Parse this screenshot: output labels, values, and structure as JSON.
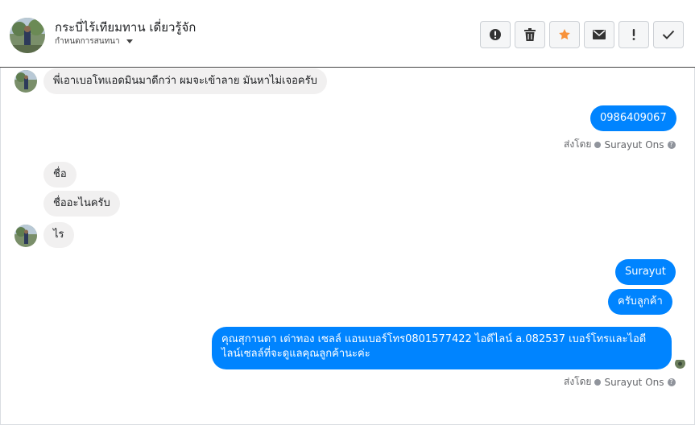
{
  "header": {
    "contact_name": "กระบี่ไร้เทียมทาน เดี่ยวรู้จัก",
    "label_text": "กำหนดการสนทนา"
  },
  "toolbar": {
    "buttons": [
      {
        "name": "spam",
        "icon": "alert-circle-icon"
      },
      {
        "name": "delete",
        "icon": "trash-icon"
      },
      {
        "name": "star",
        "icon": "star-icon",
        "color": "#f7923b"
      },
      {
        "name": "mail",
        "icon": "envelope-icon"
      },
      {
        "name": "follow-up",
        "icon": "exclamation-icon"
      },
      {
        "name": "done",
        "icon": "check-icon"
      }
    ]
  },
  "messages": [
    {
      "side": "in",
      "text": "พี่เอาเบอโทแอดมินมาดีกว่า ผมจะเข้าลาย มันหาไม่เจอครับ"
    },
    {
      "side": "out",
      "text": "0986409067"
    },
    {
      "side": "in",
      "text": "ชื่อ"
    },
    {
      "side": "in",
      "text": "ชื่ออะไนครับ"
    },
    {
      "side": "in",
      "text": "ไร"
    },
    {
      "side": "out",
      "text": "Surayut"
    },
    {
      "side": "out",
      "text": "ครับลูกค้า"
    },
    {
      "side": "out",
      "text": "คุณสุกานดา เต่าทอง  เซลล์ แอนเบอร์โทร0801577422 ไอดีไลน์ a.082537  เบอร์โทรและไอดีไลน์เซลล์ที่จะดูแลคุณลูกค้านะค่ะ"
    }
  ],
  "sent_by": {
    "prefix": "ส่งโดย",
    "name": "Surayut Ons"
  },
  "colors": {
    "outgoing_bubble": "#0084ff",
    "incoming_bubble": "#f1f0f0",
    "star": "#f7923b"
  }
}
